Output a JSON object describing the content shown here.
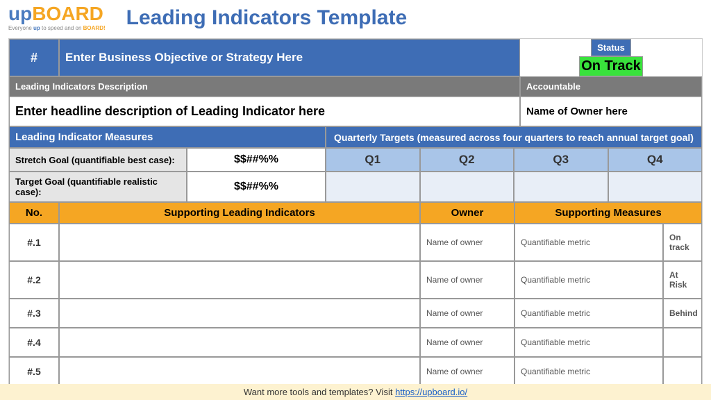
{
  "logo": {
    "up": "up",
    "board": "BOARD",
    "tagline_pre": "Everyone ",
    "tagline_b1": "up",
    "tagline_mid": " to speed and on ",
    "tagline_b2": "BOARD!"
  },
  "title": "Leading Indicators Template",
  "hdr": {
    "hash": "#",
    "objective": "Enter Business Objective or Strategy Here",
    "status_label": "Status",
    "status_value": "On Track"
  },
  "desc": {
    "label": "Leading Indicators Description",
    "accountable_label": "Accountable",
    "headline": "Enter headline description of Leading Indicator here",
    "owner": "Name of Owner here"
  },
  "measures": {
    "label": "Leading Indicator Measures",
    "qt_label": "Quarterly Targets (measured across four quarters to reach annual target goal)"
  },
  "stretch": {
    "label": "Stretch Goal (quantifiable best case):",
    "value": "$$##%%"
  },
  "target": {
    "label": "Target Goal (quantifiable realistic case):",
    "value": "$$##%%"
  },
  "quarters": {
    "q1": "Q1",
    "q2": "Q2",
    "q3": "Q3",
    "q4": "Q4"
  },
  "support_hdr": {
    "no": "No.",
    "sli": "Supporting Leading Indicators",
    "owner": "Owner",
    "sm": "Supporting Measures"
  },
  "rows": [
    {
      "no": "#.1",
      "sli": "",
      "owner": "Name of owner",
      "metric": "Quantifiable metric",
      "status": "On track",
      "status_class": "on-track"
    },
    {
      "no": "#.2",
      "sli": "",
      "owner": "Name of owner",
      "metric": "Quantifiable metric",
      "status": "At Risk",
      "status_class": "at-risk"
    },
    {
      "no": "#.3",
      "sli": "",
      "owner": "Name of owner",
      "metric": "Quantifiable metric",
      "status": "Behind",
      "status_class": "behind"
    },
    {
      "no": "#.4",
      "sli": "",
      "owner": "Name of owner",
      "metric": "Quantifiable metric",
      "status": "",
      "status_class": ""
    },
    {
      "no": "#.5",
      "sli": "",
      "owner": "Name of owner",
      "metric": "Quantifiable metric",
      "status": "",
      "status_class": ""
    }
  ],
  "footer": {
    "text": "Want more tools and templates? Visit ",
    "link": "https://upboard.io/"
  }
}
